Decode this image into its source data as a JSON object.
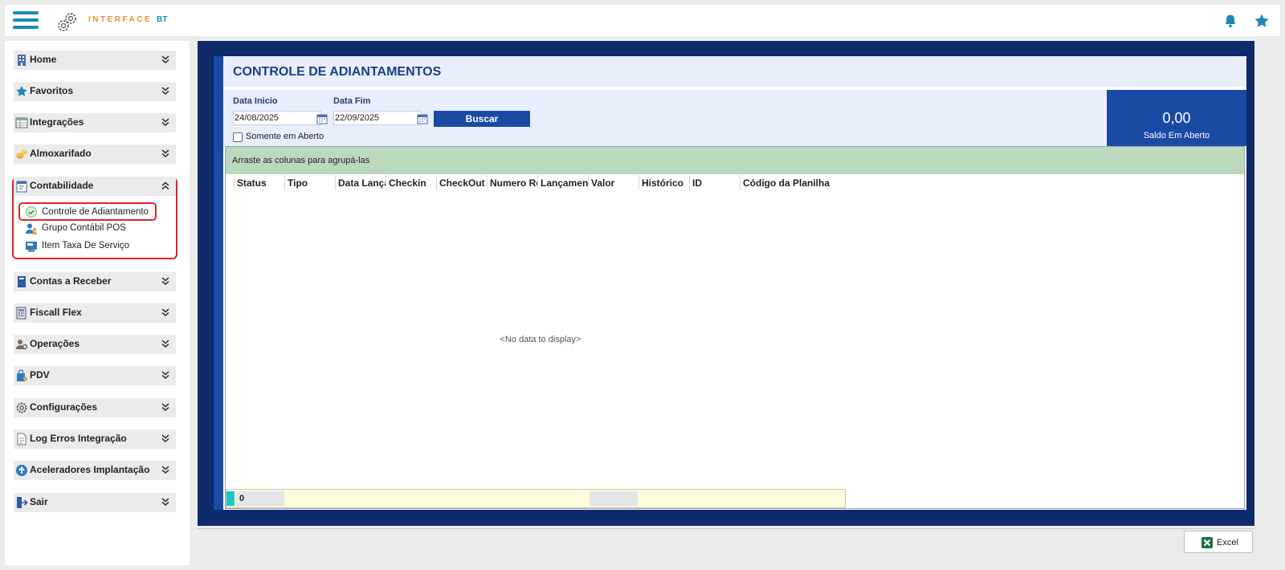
{
  "app": {
    "logo_text": "INTERFACE",
    "logo_suffix": "BT"
  },
  "sidebar": {
    "items": [
      {
        "label": "Home",
        "icon": "building-icon"
      },
      {
        "label": "Favoritos",
        "icon": "star-icon"
      },
      {
        "label": "Integrações",
        "icon": "table-icon"
      },
      {
        "label": "Almoxarifado",
        "icon": "coins-icon"
      },
      {
        "label": "Contabilidade",
        "icon": "calendar-doc-icon",
        "expanded": true
      },
      {
        "label": "Contas a Receber",
        "icon": "book-icon"
      },
      {
        "label": "Fiscall Flex",
        "icon": "calculator-icon"
      },
      {
        "label": "Operações",
        "icon": "users-gear-icon"
      },
      {
        "label": "PDV",
        "icon": "shopping-bag-icon"
      },
      {
        "label": "Configurações",
        "icon": "gear-icon"
      },
      {
        "label": "Log Erros Integração",
        "icon": "document-icon"
      },
      {
        "label": "Aceleradores Implantação",
        "icon": "arrow-up-circle-icon"
      },
      {
        "label": "Sair",
        "icon": "exit-icon"
      }
    ],
    "sub_items": [
      {
        "label": "Controle de Adiantamento",
        "icon": "check-circle-icon",
        "active": true
      },
      {
        "label": "Grupo Contábil POS",
        "icon": "user-group-icon"
      },
      {
        "label": "Item Taxa De Serviço",
        "icon": "pos-terminal-icon"
      }
    ]
  },
  "main": {
    "title": "CONTROLE DE ADIANTAMENTOS",
    "filters": {
      "start_label": "Data Inicio",
      "start_value": "24/08/2025",
      "end_label": "Data Fim",
      "end_value": "22/09/2025",
      "search_label": "Buscar",
      "only_open_label": "Somente em Aberto",
      "only_open_checked": false
    },
    "saldo": {
      "value": "0,00",
      "label": "Saldo Em Aberto"
    },
    "grid": {
      "group_hint": "Arraste as colunas para agrupá-las",
      "columns": [
        "Status",
        "Tipo",
        "Data Lançamento",
        "Checkin",
        "CheckOut",
        "Numero Reserva",
        "Lançamento",
        "Valor",
        "Histórico",
        "ID",
        "Código da Planilha"
      ],
      "empty_text": "<No data to display>",
      "footer_count": "0"
    }
  },
  "toolbar": {
    "excel_label": "Excel"
  },
  "colors": {
    "accent": "#1b4aa5",
    "frame": "#0d2a6a",
    "highlight": "#e02424",
    "group_bar": "#bcd9bd"
  }
}
